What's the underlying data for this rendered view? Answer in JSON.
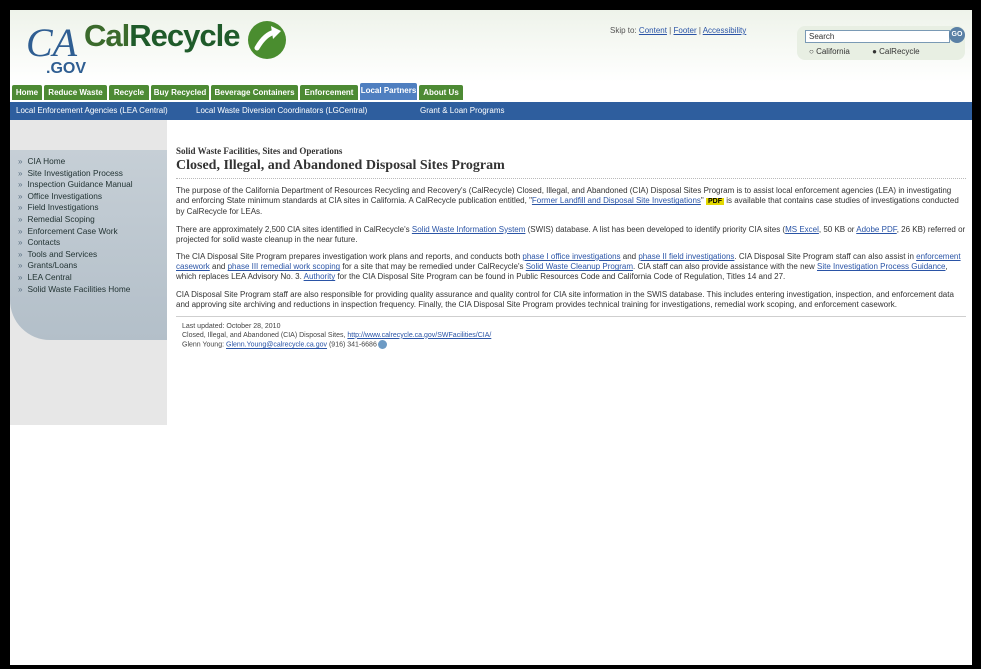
{
  "header": {
    "logo_ca": "CA",
    "logo_gov": ".GOV",
    "logo_cal": "Cal",
    "logo_recycle": "Recycle",
    "skip_to": "Skip to:",
    "skip_links": [
      "Content",
      "Footer",
      "Accessibility"
    ],
    "search_placeholder": "Search",
    "search_button": "GO",
    "search_radios": [
      "California",
      "CalRecycle"
    ]
  },
  "topnav": {
    "tabs": [
      "Home",
      "Reduce Waste",
      "Recycle",
      "Buy Recycled",
      "Beverage Containers",
      "Enforcement",
      "Local Partners",
      "About Us"
    ],
    "active_tab": "Local Partners"
  },
  "subnav": {
    "items": [
      "Local Enforcement Agencies (LEA Central)",
      "Local Waste Diversion Coordinators (LGCentral)",
      "Grant & Loan Programs"
    ]
  },
  "sidebar": {
    "items": [
      "CIA Home",
      "Site Investigation Process",
      "Inspection Guidance Manual",
      "Office Investigations",
      "Field Investigations",
      "Remedial Scoping",
      "Enforcement Case Work",
      "Contacts",
      "Tools and Services",
      "Grants/Loans",
      "LEA Central",
      "Solid Waste Facilities Home"
    ]
  },
  "content": {
    "breadcrumb": "Solid Waste Facilities, Sites and Operations",
    "title": "Closed, Illegal, and Abandoned Disposal Sites Program",
    "p1_a": "The purpose of the California Department of Resources Recycling and Recovery's (CalRecycle) Closed, Illegal, and Abandoned (CIA) Disposal Sites Program is to assist local enforcement agencies (LEA) in investigating and enforcing State minimum standards at CIA sites in California. A CalRecycle publication entitled, \"",
    "p1_link": "Former Landfill and Disposal Site Investigations",
    "p1_b": "\" ",
    "p1_pdf": "PDF",
    "p1_c": " is available that contains case studies of investigations conducted by CalRecycle for LEAs.",
    "p2_a": "There are approximately 2,500 CIA sites identified in CalRecycle's ",
    "p2_link1": "Solid Waste Information System",
    "p2_b": " (SWIS) database. A list has been developed to identify priority CIA sites (",
    "p2_link2": "MS Excel",
    "p2_c": ", 50 KB or ",
    "p2_link3": "Adobe PDF",
    "p2_d": ", 26 KB) referred or projected for solid waste cleanup in the near future.",
    "p3_a": "The CIA Disposal Site Program prepares investigation work plans and reports, and conducts both ",
    "p3_link1": "phase I office investigations",
    "p3_b": " and ",
    "p3_link2": "phase II field investigations",
    "p3_c": ". CIA Disposal Site Program staff can also assist in ",
    "p3_link3": "enforcement casework",
    "p3_d": " and ",
    "p3_link4": "phase III remedial work scoping",
    "p3_e": " for a site that may be remedied under CalRecycle's ",
    "p3_link5": "Solid Waste Cleanup Program",
    "p3_f": ". CIA staff can also provide assistance with the new ",
    "p3_link6": "Site Investigation Process Guidance",
    "p3_g": ", which replaces LEA Advisory No. 3. ",
    "p3_link7": "Authority",
    "p3_h": " for the CIA Disposal Site Program can be found in Public Resources Code and California Code of Regulation, Titles 14 and 27.",
    "p4": "CIA Disposal Site Program staff are also responsible for providing quality assurance and quality control for CIA site information in the SWIS database. This includes entering investigation, inspection, and enforcement data and approving site archiving and reductions in inspection frequency. Finally, the CIA Disposal Site Program provides technical training for investigations, remedial work scoping, and enforcement casework."
  },
  "footer": {
    "last_updated": "Last updated: October 28, 2010",
    "line2_text": "Closed, Illegal, and Abandoned (CIA) Disposal Sites, ",
    "line2_link": "http://www.calrecycle.ca.gov/SWFacilities/CIA/",
    "line3_text": "Glenn Young: ",
    "line3_link": "Glenn.Young@calrecycle.ca.gov",
    "line3_phone": " (916) 341-6686"
  },
  "colors": {
    "nav_green": "#4d8a34",
    "nav_active": "#4f7fc0",
    "subnav_blue": "#2e5e9e",
    "link_blue": "#2a54a6"
  }
}
